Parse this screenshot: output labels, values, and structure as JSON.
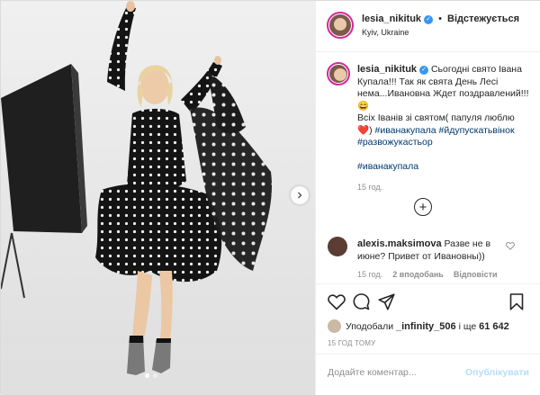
{
  "header": {
    "username": "lesia_nikituk",
    "verified_mark": "✓",
    "separator": "•",
    "follow_state": "Відстежується",
    "location": "Kyiv, Ukraine"
  },
  "caption": {
    "username": "lesia_nikituk",
    "line1": "Сьогодні свято Івана Купала!!! Так як свята День Лесі нема...Ивановна Ждет поздравлений!!!",
    "emoji_smile": "😄",
    "line2_start": "Всіх Іванів зі святом( папуля люблю",
    "heart": "❤️",
    "line2_end": ")",
    "hashtags_inline": [
      "#иванакупала",
      "#йдупускатьвінок",
      "#развожукастьор"
    ],
    "hashtag_bottom": "#иванакупала",
    "time": "15 год."
  },
  "comment": {
    "username": "alexis.maksimova",
    "text": "Разве не в июне? Привет от Ивановны))",
    "time": "15 год.",
    "likes": "2 вподобань",
    "reply": "Відповісти"
  },
  "likes": {
    "prefix": "Уподобали",
    "user": "_infinity_506",
    "middle": "і ще",
    "count": "61 642"
  },
  "timestamp": "15 ГОД ТОМУ",
  "add_comment": {
    "placeholder": "Додайте коментар...",
    "publish": "Опублікувати"
  },
  "icons": {
    "like": "heart-outline-icon",
    "comment": "speech-bubble-icon",
    "share": "paper-plane-icon",
    "save": "bookmark-icon",
    "more": "plus-circle-icon",
    "next": "chevron-right-icon",
    "comment_like": "small-heart-icon"
  },
  "colors": {
    "link": "#00376b",
    "verified": "#3897f0",
    "publish_disabled": "#b2dffc",
    "meta": "#8e8e8e"
  },
  "carousel": {
    "slides": 2,
    "active": 1
  },
  "photo": {
    "brand_text": "Profoto"
  }
}
